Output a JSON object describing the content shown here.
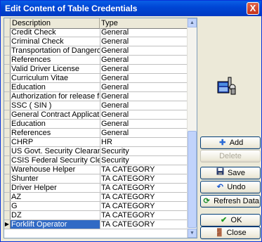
{
  "window": {
    "title": "Edit Content of Table Credentials",
    "close_label": "X"
  },
  "grid": {
    "headers": [
      "Description",
      "Type"
    ],
    "rows": [
      {
        "description": "Credit Check",
        "type": "General"
      },
      {
        "description": "Criminal Check",
        "type": "General"
      },
      {
        "description": "Transportation of Dangerous Goods",
        "type": "General"
      },
      {
        "description": "References",
        "type": "General"
      },
      {
        "description": "Valid Driver License",
        "type": "General"
      },
      {
        "description": "Curriculum Vitae",
        "type": "General"
      },
      {
        "description": "Education",
        "type": "General"
      },
      {
        "description": "Authorization for release form",
        "type": "General"
      },
      {
        "description": "SSC ( SIN )",
        "type": "General"
      },
      {
        "description": "General Contract Application",
        "type": "General"
      },
      {
        "description": "Education",
        "type": "General"
      },
      {
        "description": "References",
        "type": "General"
      },
      {
        "description": "CHRP",
        "type": "HR"
      },
      {
        "description": "US Govt. Security Clearance",
        "type": "Security"
      },
      {
        "description": "CSIS Federal Security Clearance",
        "type": "Security"
      },
      {
        "description": "Warehouse Helper",
        "type": "TA CATEGORY"
      },
      {
        "description": "Shunter",
        "type": "TA CATEGORY"
      },
      {
        "description": "Driver Helper",
        "type": "TA CATEGORY"
      },
      {
        "description": "AZ",
        "type": "TA CATEGORY"
      },
      {
        "description": "G",
        "type": "TA CATEGORY"
      },
      {
        "description": "DZ",
        "type": "TA CATEGORY"
      },
      {
        "description": "Forklift Operator",
        "type": "TA CATEGORY"
      }
    ],
    "selected_index": 21
  },
  "buttons": {
    "add": "Add",
    "delete": "Delete",
    "save": "Save",
    "undo": "Undo",
    "refresh": "Refresh Data",
    "ok": "OK",
    "close": "Close"
  },
  "icons": {
    "add": "add-icon",
    "save": "floppy-disk-icon",
    "undo": "undo-icon",
    "refresh": "refresh-icon",
    "ok": "checkmark-icon",
    "close": "exit-icon",
    "logo": "table-tools-icon"
  }
}
